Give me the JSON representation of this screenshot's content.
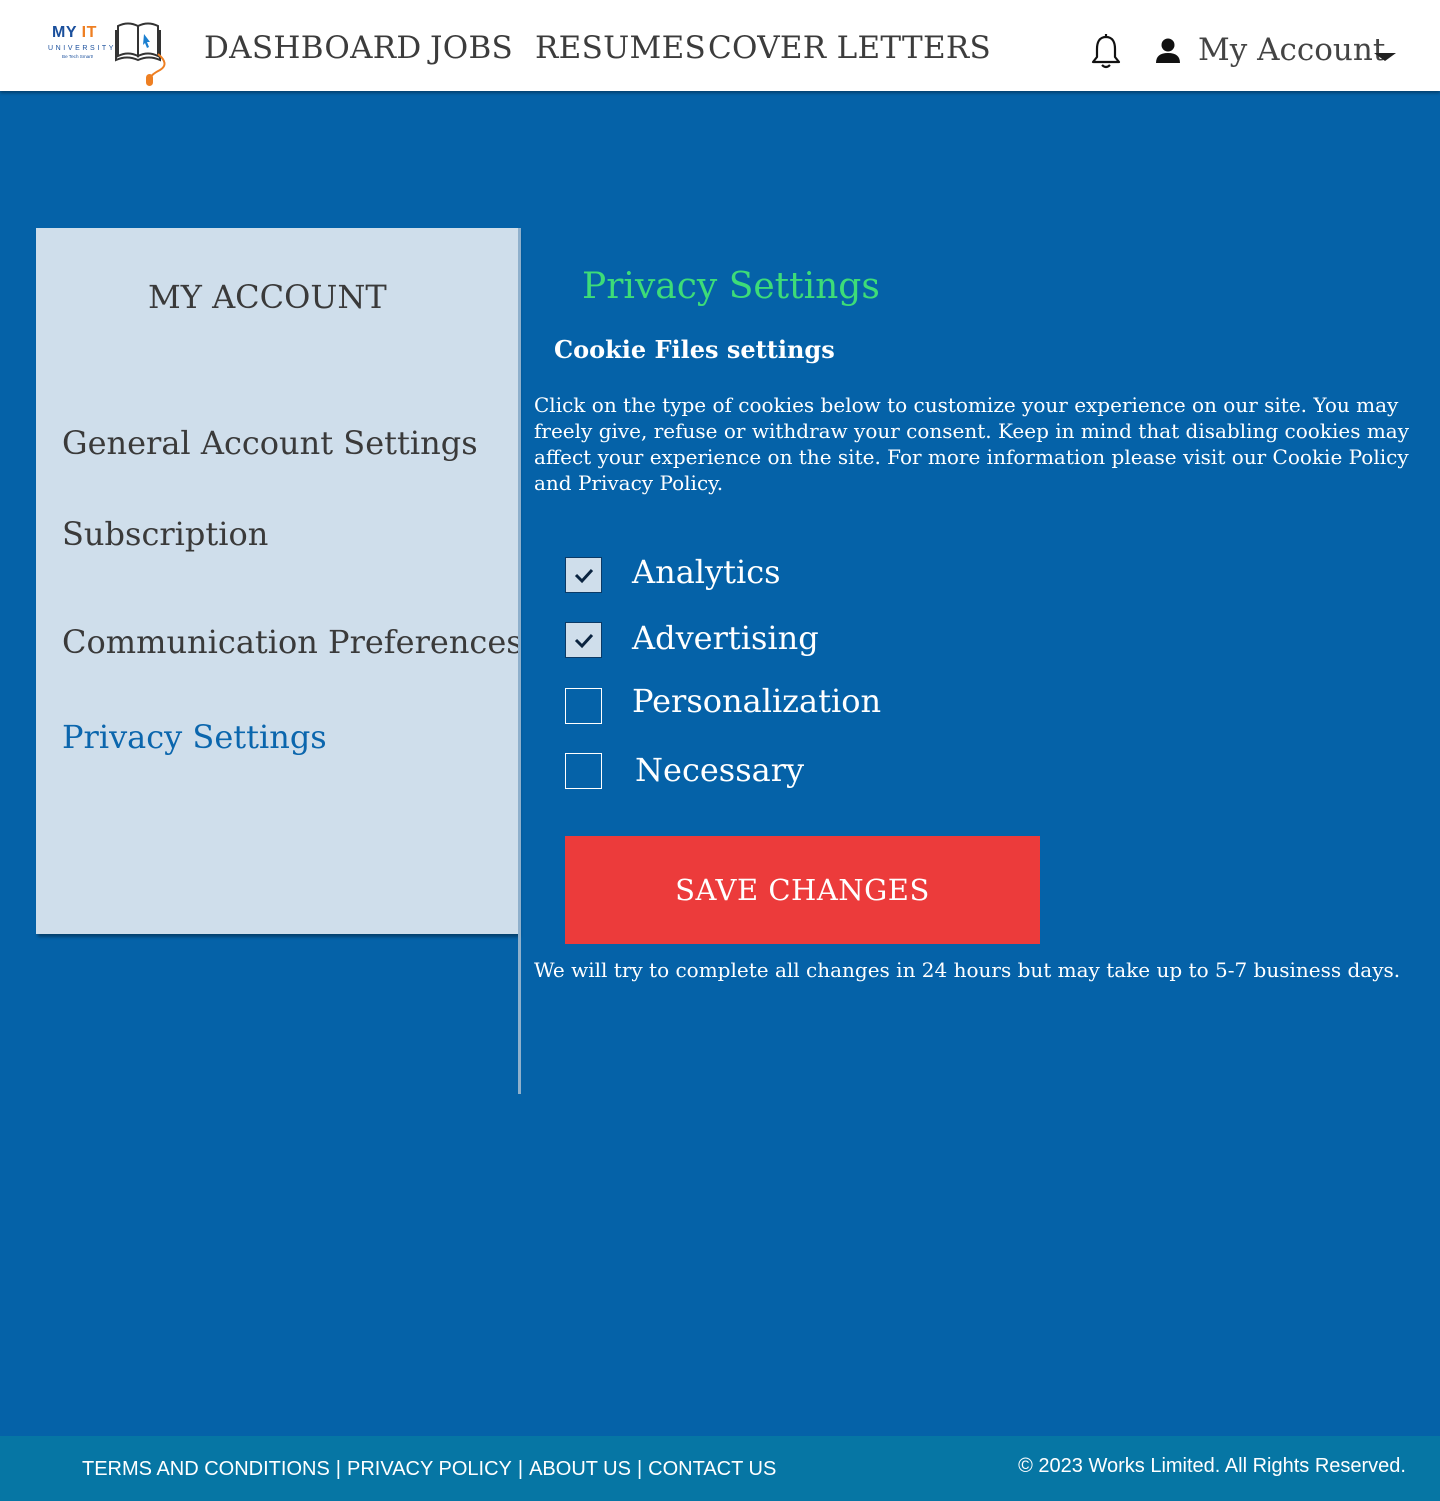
{
  "header": {
    "logo": {
      "line1_my": "MY",
      "line1_it": "IT",
      "line2": "UNIVERSITY",
      "tagline": "Be Tech Smart!"
    },
    "nav": [
      "DASHBOARD",
      "JOBS",
      "RESUMES",
      "COVER LETTERS"
    ],
    "account_label": "My Account",
    "icons": [
      "bell-icon",
      "person-icon",
      "caret-down-icon"
    ]
  },
  "sidebar": {
    "title": "MY ACCOUNT",
    "items": [
      {
        "label": "General Account Settings",
        "active": false
      },
      {
        "label": "Subscription",
        "active": false
      },
      {
        "label": "Communication Preferences",
        "active": false
      },
      {
        "label": "Privacy Settings",
        "active": true
      }
    ]
  },
  "main": {
    "title": "Privacy Settings",
    "subtitle": "Cookie Files settings",
    "description": "Click on the type of cookies below to customize your experience on our site. You may freely give, refuse or withdraw your consent. Keep in mind that disabling cookies may affect your experience on the site. For more information please visit our Cookie Policy and Privacy Policy.",
    "options": [
      {
        "label": "Analytics",
        "checked": true
      },
      {
        "label": "Advertising",
        "checked": true
      },
      {
        "label": "Personalization",
        "checked": false
      },
      {
        "label": "Necessary",
        "checked": false
      }
    ],
    "save_label": "SAVE CHANGES",
    "note": "We will try to complete all changes in 24 hours but may take up to 5-7 business days."
  },
  "footer": {
    "links": [
      "TERMS AND CONDITIONS",
      "PRIVACY POLICY",
      "ABOUT US",
      "CONTACT US"
    ],
    "separator": "|",
    "copyright": "© 2023 Works Limited. All Rights Reserved."
  },
  "colors": {
    "background": "#0562a8",
    "title_green": "#3ddc78",
    "save_button": "#ec3b3b",
    "sidebar_bg": "#cfdeeb",
    "footer_bg": "#0676a4",
    "active_item": "#0b66ad"
  }
}
